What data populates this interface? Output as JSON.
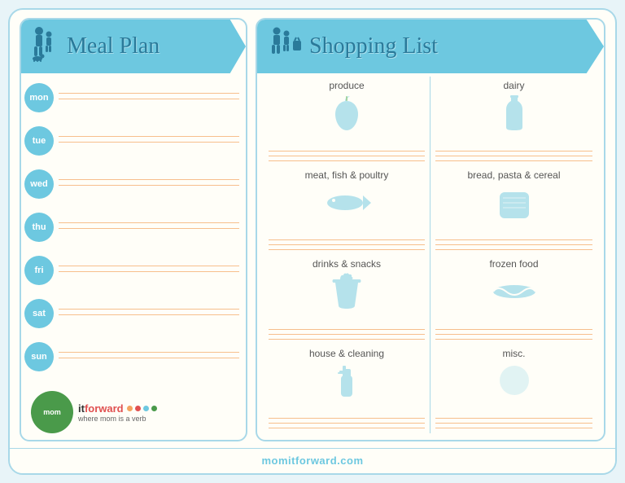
{
  "meal_plan": {
    "title": "Meal Plan",
    "days": [
      {
        "short": "mon"
      },
      {
        "short": "tue"
      },
      {
        "short": "wed"
      },
      {
        "short": "thu"
      },
      {
        "short": "fri"
      },
      {
        "short": "sat"
      },
      {
        "short": "sun"
      }
    ]
  },
  "shopping_list": {
    "title": "Shopping List",
    "sections": [
      {
        "id": "produce",
        "label": "produce",
        "icon": "apple"
      },
      {
        "id": "dairy",
        "label": "dairy",
        "icon": "bottle"
      },
      {
        "id": "meat",
        "label": "meat, fish & poultry",
        "icon": "fish"
      },
      {
        "id": "bread",
        "label": "bread, pasta & cereal",
        "icon": "bread"
      },
      {
        "id": "drinks",
        "label": "drinks & snacks",
        "icon": "cup"
      },
      {
        "id": "frozen",
        "label": "frozen food",
        "icon": "frozen"
      },
      {
        "id": "house",
        "label": "house & cleaning",
        "icon": "spray"
      },
      {
        "id": "misc",
        "label": "misc.",
        "icon": "misc"
      }
    ]
  },
  "logo": {
    "circle_text": "mom",
    "forward_label": "forward",
    "tagline": "where mom is a verb",
    "dot_colors": [
      "#f4a460",
      "#e05050",
      "#6dc8e0",
      "#4a9a4a"
    ]
  },
  "footer": {
    "url": "momitforward.com"
  }
}
